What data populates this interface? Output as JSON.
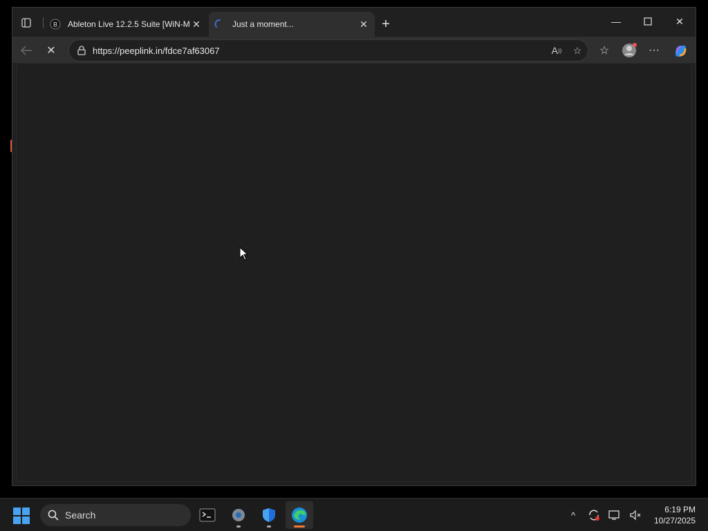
{
  "browser": {
    "tabs": [
      {
        "title": "Ableton Live 12.2.5 Suite [WiN-M",
        "favicon": "site-icon",
        "active": false
      },
      {
        "title": "Just a moment...",
        "favicon": "loading-icon",
        "active": true
      }
    ],
    "address": {
      "url": "https://peeplink.in/fdce7af63067"
    },
    "icons": {
      "tab_actions": "tab-actions-icon",
      "new_tab": "plus-icon",
      "back": "back-arrow-icon",
      "stop": "stop-loading-icon",
      "read_aloud": "read-aloud-icon",
      "favorite": "star-icon",
      "favorites": "favorites-icon",
      "profile": "profile-icon",
      "more": "more-icon",
      "copilot": "copilot-icon"
    }
  },
  "taskbar": {
    "search_label": "Search",
    "apps": [
      "terminal",
      "settings",
      "security",
      "edge"
    ],
    "clock": {
      "time": "6:19 PM",
      "date": "10/27/2025"
    }
  },
  "colors": {
    "accent": "#f07a3a",
    "background": "#1f1f1f"
  }
}
